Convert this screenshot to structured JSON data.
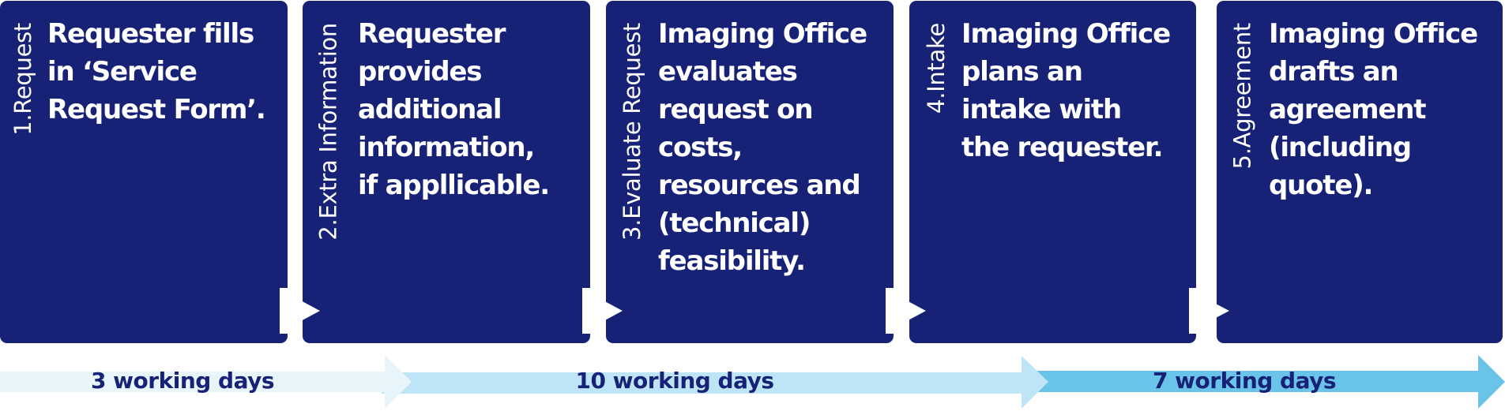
{
  "colors": {
    "card_bg": "#172277",
    "card_text": "#ffffff",
    "arrow_1": "#e8f5fb",
    "arrow_2": "#bde5f5",
    "arrow_3": "#6ac3e8",
    "arrow_text": "#172277"
  },
  "steps": [
    {
      "label": "1.Request",
      "text": "Requester fills\nin ‘Service\nRequest Form’."
    },
    {
      "label": "2.Extra Information",
      "text": "Requester\nprovides\nadditional\ninformation,\nif appllicable."
    },
    {
      "label": "3.Evaluate Request",
      "text": "Imaging Office\nevaluates\nrequest on\ncosts,\nresources and\n(technical)\nfeasibility."
    },
    {
      "label": "4.Intake",
      "text": "Imaging Office\nplans an\nintake with\nthe requester."
    },
    {
      "label": "5.Agreement",
      "text": "Imaging Office\ndrafts an\nagreement\n(including\nquote)."
    }
  ],
  "timeline": [
    {
      "label": "3 working days",
      "icon": "arrow-right-icon"
    },
    {
      "label": "10 working days",
      "icon": "arrow-right-icon"
    },
    {
      "label": "7 working days",
      "icon": "arrow-right-icon"
    }
  ]
}
